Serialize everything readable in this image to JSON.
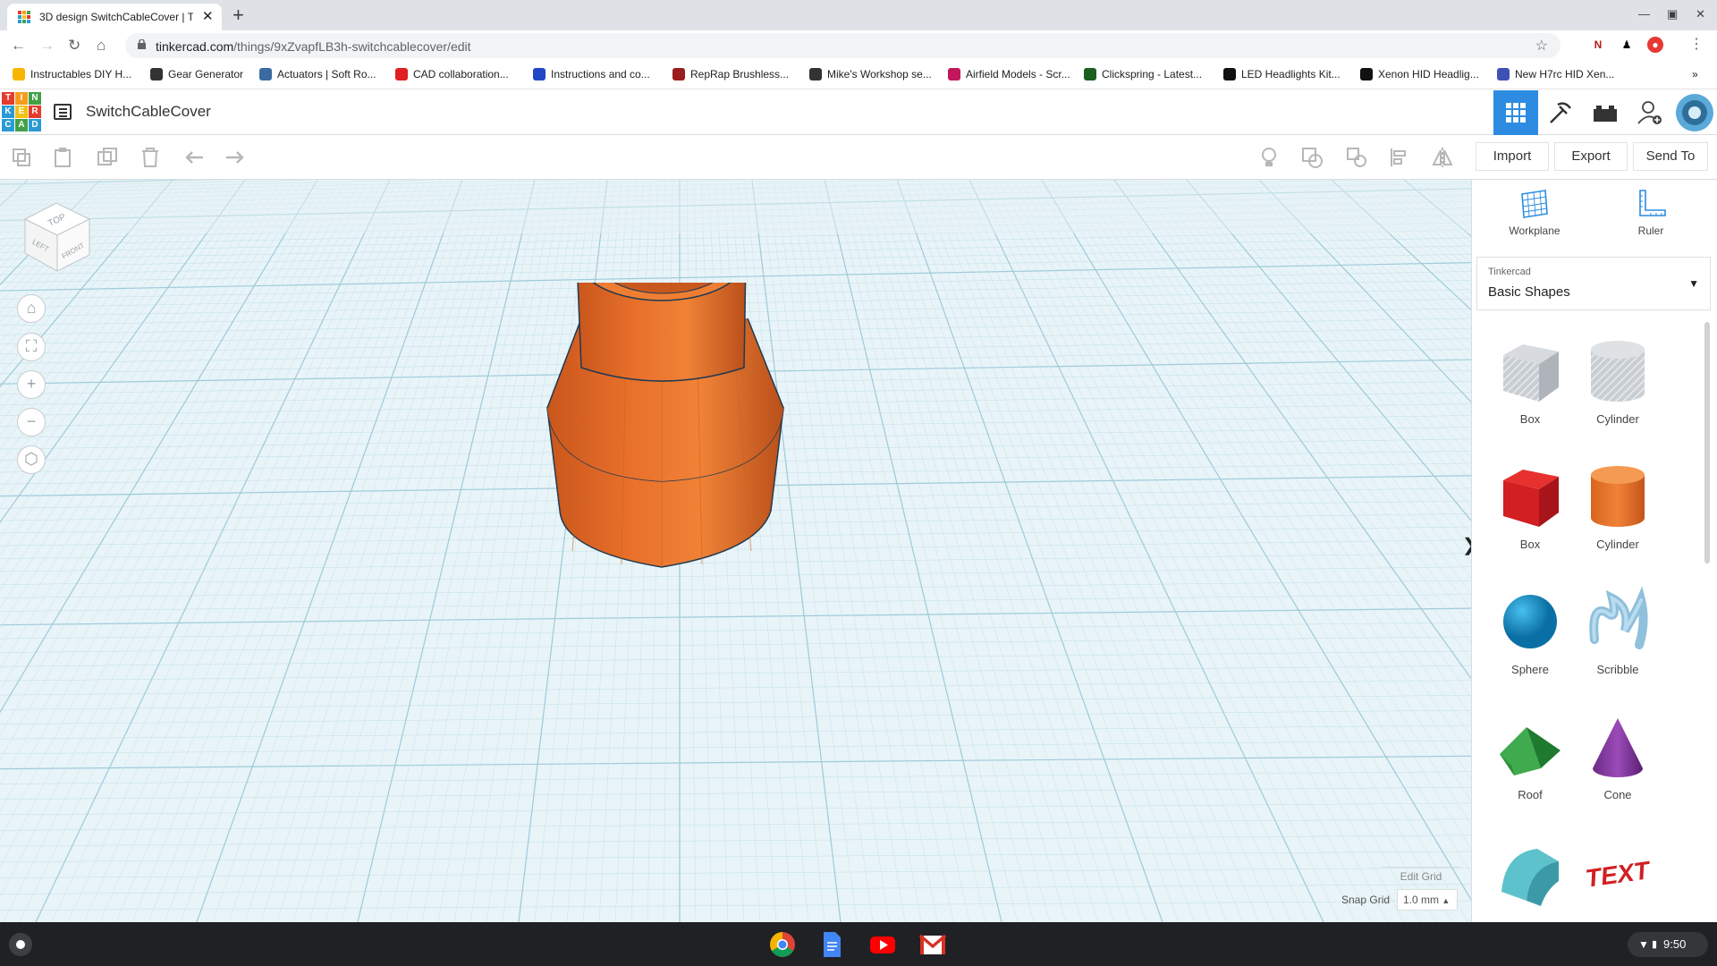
{
  "browser": {
    "tab_title": "3D design SwitchCableCover | Ti",
    "url_host": "tinkercad.com",
    "url_path": "/things/9xZvapfLB3h-switchcablecover/edit",
    "bookmarks": [
      {
        "label": "Instructables DIY H...",
        "color": "#f7b500"
      },
      {
        "label": "Gear Generator",
        "color": "#333333"
      },
      {
        "label": "Actuators | Soft Ro...",
        "color": "#3b6aa0"
      },
      {
        "label": "CAD collaboration...",
        "color": "#e02020"
      },
      {
        "label": "Instructions and co...",
        "color": "#2146c7"
      },
      {
        "label": "RepRap Brushless...",
        "color": "#9b1c1c"
      },
      {
        "label": "Mike's Workshop se...",
        "color": "#333333"
      },
      {
        "label": "Airfield Models - Scr...",
        "color": "#c2185b"
      },
      {
        "label": "Clickspring - Latest...",
        "color": "#1b5e20"
      },
      {
        "label": "LED Headlights Kit...",
        "color": "#111111"
      },
      {
        "label": "Xenon HID Headlig...",
        "color": "#111111"
      },
      {
        "label": "New H7rc HID Xen...",
        "color": "#3f51b5"
      }
    ]
  },
  "app": {
    "design_name": "SwitchCableCover",
    "logo_letters": [
      "T",
      "I",
      "N",
      "K",
      "E",
      "R",
      "C",
      "A",
      "D"
    ],
    "logo_colors": [
      "#e63a2d",
      "#f79b1c",
      "#42a146",
      "#2a9ad4",
      "#f2c212",
      "#e63a2d",
      "#2a9ad4",
      "#42a146",
      "#2a9ad4"
    ],
    "actions": {
      "import": "Import",
      "export": "Export",
      "send_to": "Send To"
    },
    "accent": "#2d8ce1"
  },
  "workplane": {
    "view_cube": {
      "top": "TOP",
      "front": "FRONT",
      "left": "LEFT"
    },
    "edit_grid": "Edit Grid",
    "snap_grid_label": "Snap Grid",
    "snap_grid_value": "1.0 mm",
    "object_color": "#e8702b"
  },
  "panel": {
    "workplane_label": "Workplane",
    "ruler_label": "Ruler",
    "library_label": "Tinkercad",
    "library_value": "Basic Shapes",
    "shapes": [
      {
        "label": "Box",
        "icon": "box-hole-icon"
      },
      {
        "label": "Cylinder",
        "icon": "cylinder-hole-icon"
      },
      {
        "label": "Box",
        "icon": "box-red-icon"
      },
      {
        "label": "Cylinder",
        "icon": "cylinder-orange-icon"
      },
      {
        "label": "Sphere",
        "icon": "sphere-icon"
      },
      {
        "label": "Scribble",
        "icon": "scribble-icon"
      },
      {
        "label": "Roof",
        "icon": "roof-icon"
      },
      {
        "label": "Cone",
        "icon": "cone-icon"
      },
      {
        "label": "",
        "icon": "round-roof-icon"
      },
      {
        "label": "",
        "icon": "text-icon"
      }
    ]
  },
  "shelf": {
    "time": "9:50"
  }
}
